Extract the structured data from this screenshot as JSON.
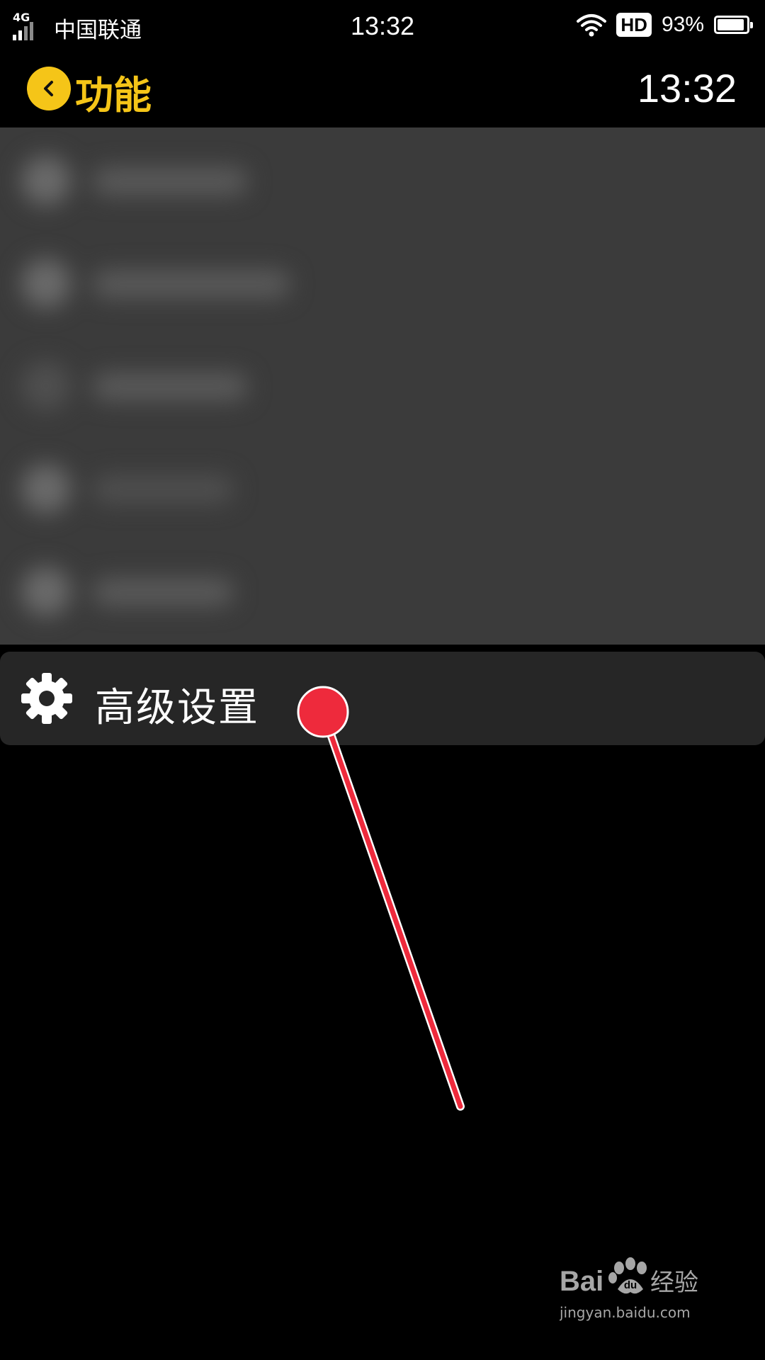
{
  "status_bar": {
    "network": "4G",
    "carrier": "中国联通",
    "time": "13:32",
    "hd": "HD",
    "battery": "93%",
    "battery_level": 0.93
  },
  "header": {
    "title": "功能",
    "clock": "13:32",
    "accent_color": "#f5c518"
  },
  "settings_item": {
    "label": "高级设置",
    "icon": "gear-icon"
  },
  "annotation_color": "#ee2a3c",
  "watermark": {
    "brand_left": "Bai",
    "brand_right": "经验",
    "url": "jingyan.baidu.com"
  }
}
